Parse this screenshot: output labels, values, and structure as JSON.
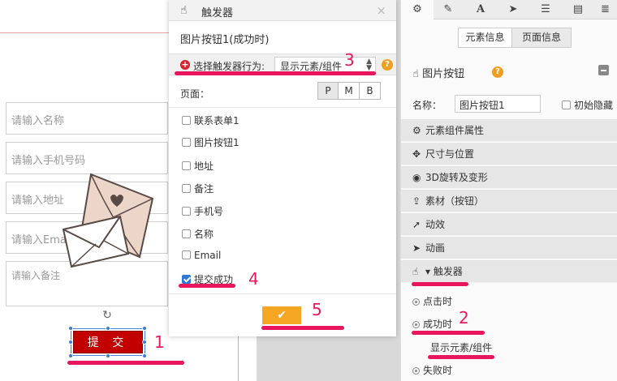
{
  "canvas": {
    "inputs": [
      "请输入名称",
      "请输入手机号码",
      "请输入地址",
      "请输入Email"
    ],
    "textarea_placeholder": "请输入备注",
    "submit_label": "提 交"
  },
  "dialog": {
    "title": "触发器",
    "close": "×",
    "subtitle": "图片按钮1(成功时)",
    "behavior_label": "选择触发器行为:",
    "behavior_value": "显示元素/组件",
    "page_label": "页面：",
    "page_segments": [
      "P",
      "M",
      "B"
    ],
    "items": [
      {
        "label": "联系表单1",
        "checked": false
      },
      {
        "label": "图片按钮1",
        "checked": false
      },
      {
        "label": "地址",
        "checked": false
      },
      {
        "label": "备注",
        "checked": false
      },
      {
        "label": "手机号",
        "checked": false
      },
      {
        "label": "名称",
        "checked": false
      },
      {
        "label": "Email",
        "checked": false
      },
      {
        "label": "提交成功",
        "checked": true
      }
    ],
    "ok": "✔"
  },
  "panel": {
    "tabs": [
      "gear-icon",
      "pencil-icon",
      "text-icon",
      "send-icon",
      "list-icon",
      "page-icon",
      "database-icon"
    ],
    "seg_element": "元素信息",
    "seg_page": "页面信息",
    "element_title": "图片按钮",
    "name_label": "名称：",
    "name_value": "图片按钮1",
    "hidden_label": "初始隐藏",
    "sections": [
      {
        "icon": "⚙",
        "label": "元素组件属性"
      },
      {
        "icon": "✥",
        "label": "尺寸与位置"
      },
      {
        "icon": "◉",
        "label": "3D旋转及变形"
      },
      {
        "icon": "⇪",
        "label": "素材（按钮）"
      },
      {
        "icon": "➚",
        "label": "动效"
      },
      {
        "icon": "➤",
        "label": "动画"
      }
    ],
    "trigger_header": "触发器",
    "trigger_items": [
      "点击时",
      "成功时"
    ],
    "trigger_link": "显示元素/组件",
    "trigger_failed": "失败时"
  },
  "annotations": [
    "1",
    "2",
    "3",
    "4",
    "5"
  ],
  "colors": {
    "annotation": "#e8175d",
    "submit": "#c20000",
    "ok": "#f5a623",
    "help": "#f0a020"
  }
}
